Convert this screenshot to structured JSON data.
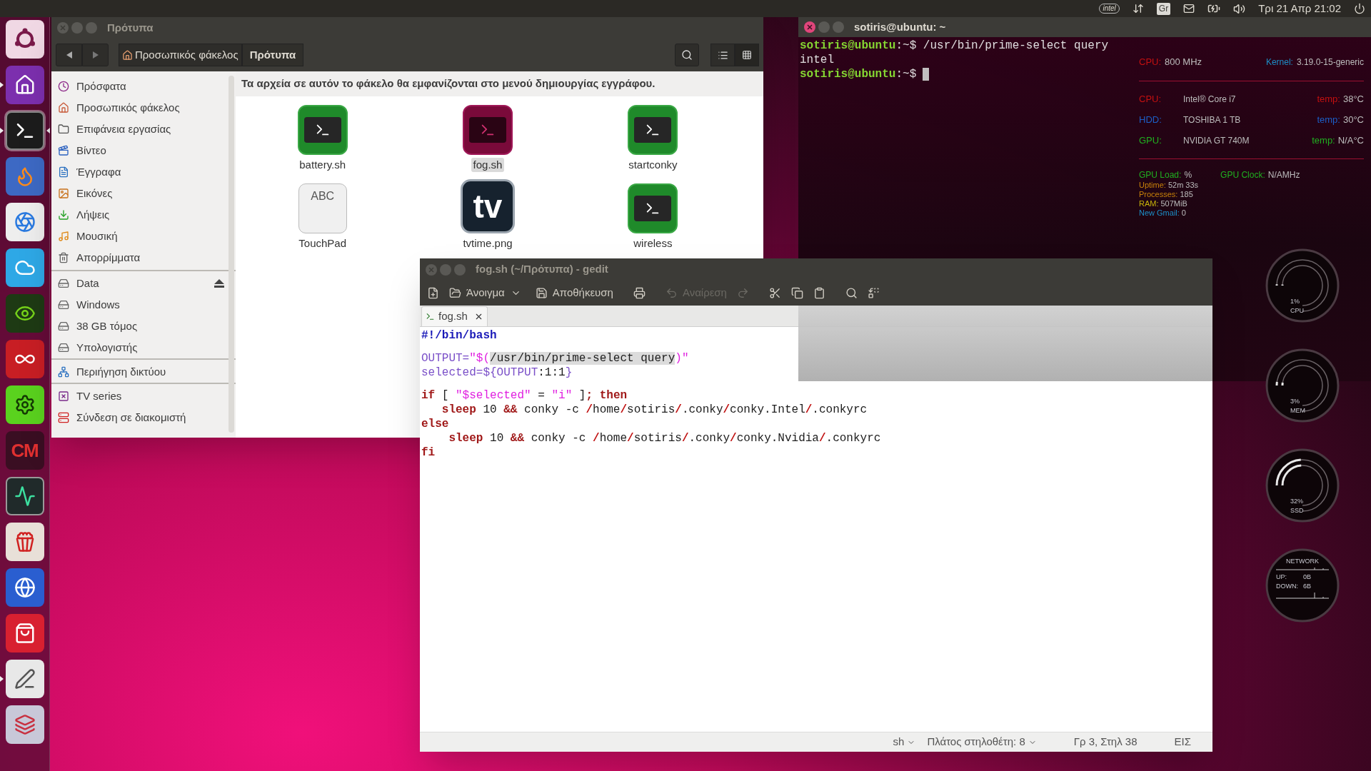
{
  "top_panel": {
    "indicators": [
      {
        "kind": "logo",
        "label": "intel"
      },
      {
        "kind": "network"
      },
      {
        "kind": "keyboard",
        "label": "Gr"
      },
      {
        "kind": "mail"
      },
      {
        "kind": "battery"
      },
      {
        "kind": "volume"
      },
      {
        "kind": "clock",
        "label": "Τρι 21 Απρ 21:02"
      },
      {
        "kind": "session"
      }
    ]
  },
  "launcher": {
    "items": [
      {
        "kind": "ubuntu",
        "running": false,
        "selected": false
      },
      {
        "kind": "home",
        "running": true,
        "selected": false
      },
      {
        "kind": "terminal",
        "running": true,
        "selected": true
      },
      {
        "kind": "firefox",
        "running": false,
        "selected": false
      },
      {
        "kind": "chrome",
        "running": false,
        "selected": false
      },
      {
        "kind": "skype",
        "running": false,
        "selected": false
      },
      {
        "kind": "nvidia",
        "running": false,
        "selected": false
      },
      {
        "kind": "e",
        "running": false,
        "selected": false
      },
      {
        "kind": "tweak",
        "running": false,
        "selected": false
      },
      {
        "kind": "cm",
        "label": "CM",
        "running": false,
        "selected": false
      },
      {
        "kind": "monitor",
        "running": false,
        "selected": false
      },
      {
        "kind": "popcorn",
        "running": false,
        "selected": false
      },
      {
        "kind": "globe",
        "running": false,
        "selected": false
      },
      {
        "kind": "software",
        "running": false,
        "selected": false
      },
      {
        "kind": "editor",
        "running": true,
        "selected": false
      },
      {
        "kind": "stack",
        "running": false,
        "selected": false
      }
    ]
  },
  "file_manager": {
    "window": {
      "title": "Πρότυπα",
      "active": false
    },
    "breadcrumb": [
      {
        "label": "Προσωπικός φάκελος",
        "kind": "home",
        "selected": false
      },
      {
        "label": "Πρότυπα",
        "kind": "folder",
        "selected": true
      }
    ],
    "sidebar": {
      "groups": [
        {
          "items": [
            {
              "label": "Πρόσφατα",
              "kind": "recent"
            },
            {
              "label": "Προσωπικός φάκελος",
              "kind": "home"
            },
            {
              "label": "Επιφάνεια εργασίας",
              "kind": "desktop"
            },
            {
              "label": "Βίντεο",
              "kind": "video"
            },
            {
              "label": "Έγγραφα",
              "kind": "documents"
            },
            {
              "label": "Εικόνες",
              "kind": "pictures"
            },
            {
              "label": "Λήψεις",
              "kind": "downloads"
            },
            {
              "label": "Μουσική",
              "kind": "music"
            },
            {
              "label": "Απορρίμματα",
              "kind": "trash"
            }
          ]
        },
        {
          "items": [
            {
              "label": "Data",
              "kind": "drive",
              "ejectable": true
            },
            {
              "label": "Windows",
              "kind": "drive",
              "ejectable": false
            },
            {
              "label": "38 GB τόμος",
              "kind": "drive",
              "ejectable": false
            },
            {
              "label": "Υπολογιστής",
              "kind": "drive",
              "ejectable": false
            }
          ]
        },
        {
          "items": [
            {
              "label": "Περιήγηση δικτύου",
              "kind": "network"
            }
          ]
        },
        {
          "items": [
            {
              "label": "TV series",
              "kind": "bookmark"
            },
            {
              "label": "Σύνδεση σε διακομιστή",
              "kind": "server"
            }
          ]
        }
      ]
    },
    "info_bar": "Τα αρχεία σε αυτόν το φάκελο θα εμφανίζονται στο μενού δημιουργίας εγγράφου.",
    "files": [
      {
        "name": "battery.sh",
        "kind": "script",
        "selected": false
      },
      {
        "name": "fog.sh",
        "kind": "script",
        "selected": true
      },
      {
        "name": "startconky",
        "kind": "script",
        "selected": false
      },
      {
        "name": "TouchPad",
        "kind": "text",
        "glyph": "ABC",
        "selected": false
      },
      {
        "name": "tvtime.png",
        "kind": "image",
        "glyph": "tv",
        "selected": false
      },
      {
        "name": "wireless",
        "kind": "script",
        "selected": false
      }
    ]
  },
  "terminal": {
    "window": {
      "title": "sotiris@ubuntu: ~",
      "active": true
    },
    "lines": [
      {
        "kind": "prompt",
        "user": "sotiris@ubuntu",
        "rest": ":~$",
        "command": "/usr/bin/prime-select query",
        "cursor": false
      },
      {
        "kind": "output",
        "text": "intel"
      },
      {
        "kind": "prompt",
        "user": "sotiris@ubuntu",
        "rest": ":~$",
        "cursor": true
      }
    ]
  },
  "conky": {
    "header": [
      {
        "label": "CPU:",
        "value": "800 MHz",
        "color": "#c41010"
      },
      {
        "label": "Kernel:",
        "value": "3.19.0-15-generic",
        "color": "#1c8fc8"
      }
    ],
    "devices": [
      {
        "label": "CPU:",
        "name": "Intel® Core i7",
        "temp_label": "temp:",
        "temp": "38°C",
        "color": "#c41010"
      },
      {
        "label": "HDD:",
        "name": "TOSHIBA 1 TB",
        "temp_label": "temp:",
        "temp": "30°C",
        "color": "#1c5fc8"
      },
      {
        "label": "GPU:",
        "name": "NVIDIA GT 740M",
        "temp_label": "temp:",
        "temp": "N/A°C",
        "color": "#20b020"
      }
    ],
    "gpu": [
      {
        "label": "GPU Load:",
        "value": "%",
        "color": "#20b020"
      },
      {
        "label": "GPU Clock:",
        "value": "N/AMHz",
        "color": "#20b020"
      }
    ],
    "stats": [
      {
        "label": "Uptime:",
        "value": "52m 33s",
        "color": "#c8820a"
      },
      {
        "label": "Processes:",
        "value": "185",
        "color": "#c8820a"
      },
      {
        "label": "RAM:",
        "value": "507MiB",
        "color": "#c8b40a"
      },
      {
        "label": "New Gmail:",
        "value": "0",
        "color": "#1c8fc8"
      }
    ],
    "gauges": [
      {
        "reading": "1%",
        "label": "CPU",
        "level": 0.01
      },
      {
        "reading": "3%",
        "label": "MEM",
        "level": 0.03
      },
      {
        "reading": "32%",
        "label": "SSD",
        "level": 0.32
      }
    ],
    "network": {
      "title": "NETWORK",
      "rows": [
        {
          "label": "UP:",
          "value": "0B"
        },
        {
          "label": "DOWN:",
          "value": "6B"
        }
      ]
    }
  },
  "gedit": {
    "window": {
      "title": "fog.sh (~/Πρότυπα) - gedit",
      "active": false
    },
    "toolbar": [
      {
        "kind": "new",
        "disabled": false
      },
      {
        "kind": "open",
        "label": "Άνοιγμα",
        "disabled": false
      },
      {
        "kind": "dropdown",
        "disabled": false
      },
      {
        "kind": "save",
        "label": "Αποθήκευση",
        "disabled": false
      },
      {
        "kind": "print",
        "disabled": false
      },
      {
        "kind": "undo",
        "label": "Αναίρεση",
        "disabled": true
      },
      {
        "kind": "redo",
        "disabled": true
      },
      {
        "kind": "cut",
        "disabled": false
      },
      {
        "kind": "copy",
        "disabled": false
      },
      {
        "kind": "paste",
        "disabled": false
      },
      {
        "kind": "search",
        "disabled": false
      },
      {
        "kind": "replace",
        "disabled": false
      }
    ],
    "tabs": [
      {
        "label": "fog.sh",
        "selected": true
      }
    ],
    "code": [
      {
        "kind": "code",
        "tokens": [
          {
            "kind": "shebang",
            "text": "#!/bin/bash"
          }
        ]
      },
      {
        "kind": "blank"
      },
      {
        "kind": "code",
        "tokens": [
          {
            "kind": "var",
            "text": "OUTPUT="
          },
          {
            "kind": "string",
            "text": "\"$("
          },
          {
            "kind": "match",
            "text": "/usr/bin/prime-select query"
          },
          {
            "kind": "string",
            "text": ")\""
          }
        ]
      },
      {
        "kind": "code",
        "tokens": [
          {
            "kind": "var",
            "text": "selected=${OUTPUT"
          },
          {
            "kind": "plain",
            "text": ":1:1"
          },
          {
            "kind": "var",
            "text": "}"
          }
        ]
      },
      {
        "kind": "blank"
      },
      {
        "kind": "code",
        "tokens": [
          {
            "kind": "keyword",
            "text": "if"
          },
          {
            "kind": "plain",
            "text": " [ "
          },
          {
            "kind": "string",
            "text": "\"$selected\""
          },
          {
            "kind": "plain",
            "text": " = "
          },
          {
            "kind": "string",
            "text": "\"i\""
          },
          {
            "kind": "plain",
            "text": " ]"
          },
          {
            "kind": "keyword",
            "text": "; then"
          }
        ]
      },
      {
        "kind": "code",
        "tokens": [
          {
            "kind": "keyword",
            "text": "   sleep"
          },
          {
            "kind": "plain",
            "text": " 10 "
          },
          {
            "kind": "keyword",
            "text": "&&"
          },
          {
            "kind": "plain",
            "text": " conky -c "
          },
          {
            "kind": "slash",
            "text": "/"
          },
          {
            "kind": "plain",
            "text": "home"
          },
          {
            "kind": "slash",
            "text": "/"
          },
          {
            "kind": "plain",
            "text": "sotiris"
          },
          {
            "kind": "slash",
            "text": "/"
          },
          {
            "kind": "plain",
            "text": ".conky"
          },
          {
            "kind": "slash",
            "text": "/"
          },
          {
            "kind": "plain",
            "text": "conky.Intel"
          },
          {
            "kind": "slash",
            "text": "/"
          },
          {
            "kind": "plain",
            "text": ".conkyrc"
          }
        ]
      },
      {
        "kind": "code",
        "tokens": [
          {
            "kind": "keyword",
            "text": "else"
          }
        ]
      },
      {
        "kind": "code",
        "tokens": [
          {
            "kind": "keyword",
            "text": "    sleep"
          },
          {
            "kind": "plain",
            "text": " 10 "
          },
          {
            "kind": "keyword",
            "text": "&&"
          },
          {
            "kind": "plain",
            "text": " conky -c "
          },
          {
            "kind": "slash",
            "text": "/"
          },
          {
            "kind": "plain",
            "text": "home"
          },
          {
            "kind": "slash",
            "text": "/"
          },
          {
            "kind": "plain",
            "text": "sotiris"
          },
          {
            "kind": "slash",
            "text": "/"
          },
          {
            "kind": "plain",
            "text": ".conky"
          },
          {
            "kind": "slash",
            "text": "/"
          },
          {
            "kind": "plain",
            "text": "conky.Nvidia"
          },
          {
            "kind": "slash",
            "text": "/"
          },
          {
            "kind": "plain",
            "text": ".conkyrc"
          }
        ]
      },
      {
        "kind": "code",
        "tokens": [
          {
            "kind": "keyword",
            "text": "fi"
          }
        ]
      }
    ],
    "status_bar": [
      {
        "label": "sh",
        "dropdown": true
      },
      {
        "label": "Πλάτος στηλοθέτη: 8",
        "dropdown": true
      },
      {
        "label": "Γρ 3, Στηλ 38",
        "dropdown": false
      },
      {
        "label": "ΕΙΣ",
        "dropdown": false
      }
    ]
  }
}
